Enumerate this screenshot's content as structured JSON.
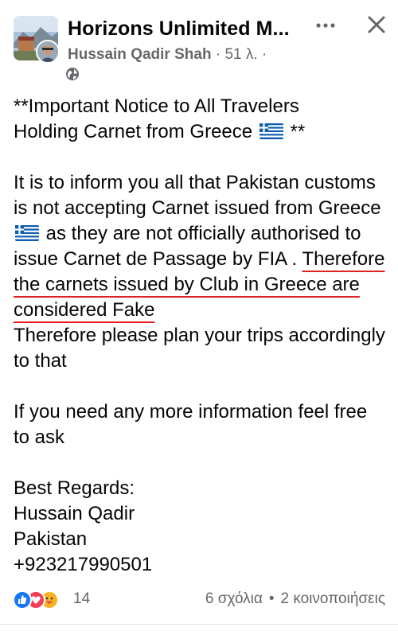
{
  "header": {
    "page_name": "Horizons Unlimited M...",
    "author": "Hussain Qadir Shah",
    "separator": " · ",
    "time": "51 λ.",
    "trailing_dot": " ·",
    "privacy_icon": "globe-icon",
    "more_icon": "more-dots-icon",
    "close_icon": "close-icon"
  },
  "post": {
    "line1": "**Important Notice to All Travelers",
    "line2_a": "Holding Carnet from Greece",
    "line2_b": " **",
    "para2_a": "It is to inform you all that Pakistan customs is not accepting Carnet issued from Greece",
    "para2_b": " as they are not officially authorised to issue Carnet de Passage by FIA . ",
    "para2_underlined": "Therefore the carnets issued by Club in Greece are considered Fake",
    "para2_c": "Therefore please plan your trips accordingly to that",
    "para3": "If you need any more information feel free to ask",
    "sign_1": "Best Regards:",
    "sign_2": "Hussain Qadir",
    "sign_3": "Pakistan",
    "sign_4": "+923217990501"
  },
  "footer": {
    "reaction_count": "14",
    "comments": "6 σχόλια",
    "dot": "•",
    "shares": "2 κοινοποιήσεις"
  },
  "colors": {
    "text": "#050505",
    "secondary": "#65676b",
    "underline": "#e02020",
    "like_blue": "#1877f2",
    "love_red": "#f33e58",
    "care_yellow": "#f7b125"
  }
}
